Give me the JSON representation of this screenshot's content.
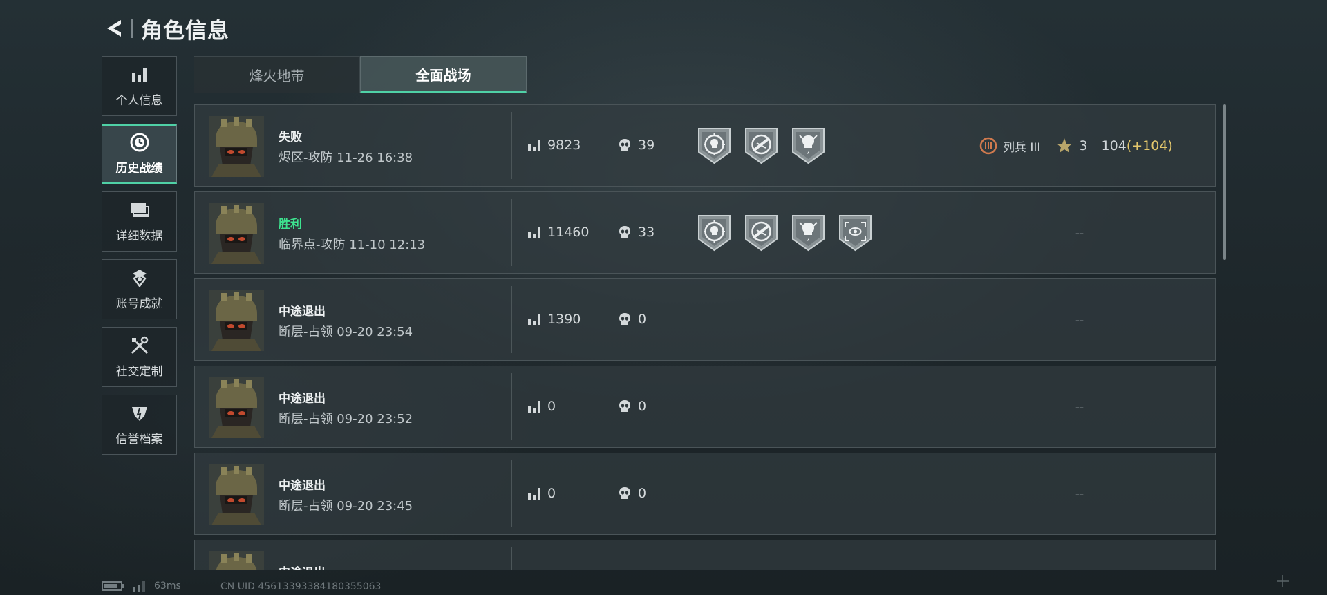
{
  "header": {
    "title": "角色信息"
  },
  "sidebar": {
    "items": [
      {
        "label": "个人信息",
        "icon": "bar-chart-icon",
        "active": false
      },
      {
        "label": "历史战绩",
        "icon": "clock-icon",
        "active": true
      },
      {
        "label": "详细数据",
        "icon": "data-cards-icon",
        "active": false
      },
      {
        "label": "账号成就",
        "icon": "achievement-icon",
        "active": false
      },
      {
        "label": "社交定制",
        "icon": "tools-icon",
        "active": false
      },
      {
        "label": "信誉档案",
        "icon": "credit-shield-icon",
        "active": false
      }
    ]
  },
  "tabs": [
    {
      "label": "烽火地带",
      "active": false
    },
    {
      "label": "全面战场",
      "active": true
    }
  ],
  "matches": [
    {
      "result": "失败",
      "win": false,
      "map": "烬区-攻防 11-26 16:38",
      "score": "9823",
      "kills": "39",
      "badges": [
        "skull-target-badge",
        "rifle-target-badge",
        "skull-rank-badge"
      ],
      "rank": {
        "name": "列兵 III",
        "stars": "3",
        "score": "104",
        "delta": "(+104)"
      }
    },
    {
      "result": "胜利",
      "win": true,
      "map": "临界点-攻防 11-10 12:13",
      "score": "11460",
      "kills": "33",
      "badges": [
        "skull-target-badge",
        "rifle-target-badge",
        "skull-rank-badge",
        "eye-scope-badge"
      ],
      "rank_empty": "--"
    },
    {
      "result": "中途退出",
      "win": false,
      "map": "断层-占领 09-20 23:54",
      "score": "1390",
      "kills": "0",
      "badges": [],
      "rank_empty": "--"
    },
    {
      "result": "中途退出",
      "win": false,
      "map": "断层-占领 09-20 23:52",
      "score": "0",
      "kills": "0",
      "badges": [],
      "rank_empty": "--"
    },
    {
      "result": "中途退出",
      "win": false,
      "map": "断层-占领 09-20 23:45",
      "score": "0",
      "kills": "0",
      "badges": [],
      "rank_empty": "--"
    },
    {
      "result": "中途退出",
      "win": false,
      "map": "",
      "score": "",
      "kills": "",
      "badges": [],
      "rank_empty": ""
    }
  ],
  "footer": {
    "ping": "63ms",
    "uid": "CN UID 456133933841803550​63"
  },
  "colors": {
    "accent": "#4fd1a6",
    "win": "#3de38f",
    "gold": "#e3c76c"
  }
}
